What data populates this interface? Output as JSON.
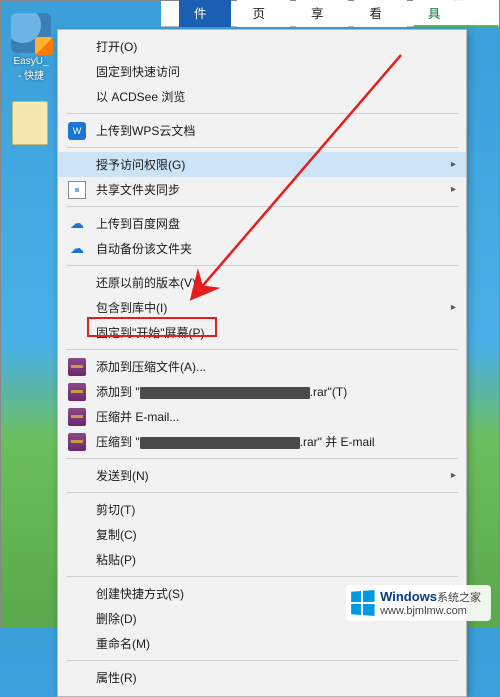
{
  "desktop": {
    "icon1_label": "EasyU_",
    "icon1_sub": "- 快捷",
    "icon2_label": ""
  },
  "tabs": {
    "file": "文件",
    "home": "主页",
    "share": "共享",
    "view": "查看",
    "tools": "驱动器工具"
  },
  "ctx": {
    "open": "打开(O)",
    "pin_quick": "固定到快速访问",
    "acdsee": "以 ACDSee 浏览",
    "wps_upload": "上传到WPS云文档",
    "grant_access": "授予访问权限(G)",
    "share_sync": "共享文件夹同步",
    "baidu_upload": "上传到百度网盘",
    "auto_backup": "自动备份该文件夹",
    "restore_prev": "还原以前的版本(V)",
    "include_lib": "包含到库中(I)",
    "pin_start": "固定到\"开始\"屏幕(P)",
    "rar_add": "添加到压缩文件(A)...",
    "rar_addto_prefix": "添加到 \"",
    "rar_addto_suffix": ".rar\"(T)",
    "rar_email": "压缩并 E-mail...",
    "rar_email_to_prefix": "压缩到 \"",
    "rar_email_to_suffix": ".rar\" 并 E-mail",
    "send_to": "发送到(N)",
    "cut": "剪切(T)",
    "copy": "复制(C)",
    "paste": "粘贴(P)",
    "shortcut": "创建快捷方式(S)",
    "delete": "删除(D)",
    "rename": "重命名(M)",
    "properties": "属性(R)"
  },
  "watermark": {
    "title": "Windows",
    "subtitle": "系统之家",
    "url": "www.bjmlmw.com"
  }
}
